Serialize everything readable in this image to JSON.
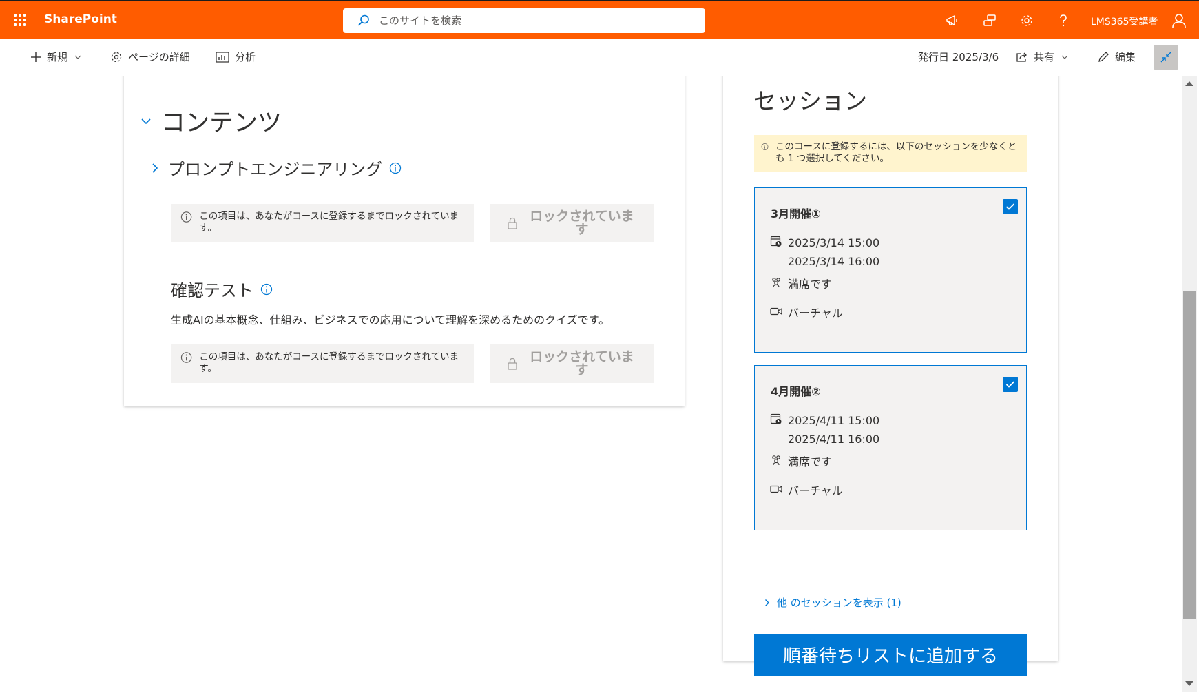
{
  "suite": {
    "brand": "SharePoint",
    "search_placeholder": "このサイトを検索",
    "user": "LMS365受講者"
  },
  "commands": {
    "new_label": "新規",
    "page_details_label": "ページの詳細",
    "analytics_label": "分析",
    "published": "発行日 2025/3/6",
    "share_label": "共有",
    "edit_label": "編集"
  },
  "contents": {
    "title": "コンテンツ",
    "modules": [
      {
        "title": "プロンプトエンジニアリング",
        "lock_message": "この項目は、あなたがコースに登録するまでロックされています。",
        "lock_button": "ロックされています"
      },
      {
        "title": "確認テスト",
        "description": "生成AIの基本概念、仕組み、ビジネスでの応用について理解を深めるためのクイズです。",
        "lock_message": "この項目は、あなたがコースに登録するまでロックされています。",
        "lock_button": "ロックされています"
      }
    ]
  },
  "sessions": {
    "title": "セッション",
    "notice": "このコースに登録するには、以下のセッションを少なくとも 1 つ選択してください。",
    "items": [
      {
        "name": "3月開催①",
        "start": "2025/3/14 15:00",
        "end": "2025/3/14 16:00",
        "seats": "満席です",
        "location": "バーチャル",
        "checked": true
      },
      {
        "name": "4月開催②",
        "start": "2025/4/11 15:00",
        "end": "2025/4/11 16:00",
        "seats": "満席です",
        "location": "バーチャル",
        "checked": true
      }
    ],
    "more_link": "他 のセッションを表示 (1)",
    "waitlist_button": "順番待ちリストに追加する"
  },
  "colors": {
    "suite_bar": "#ff5c00",
    "accent": "#0078d4",
    "notice_bg": "#fff4ce"
  }
}
